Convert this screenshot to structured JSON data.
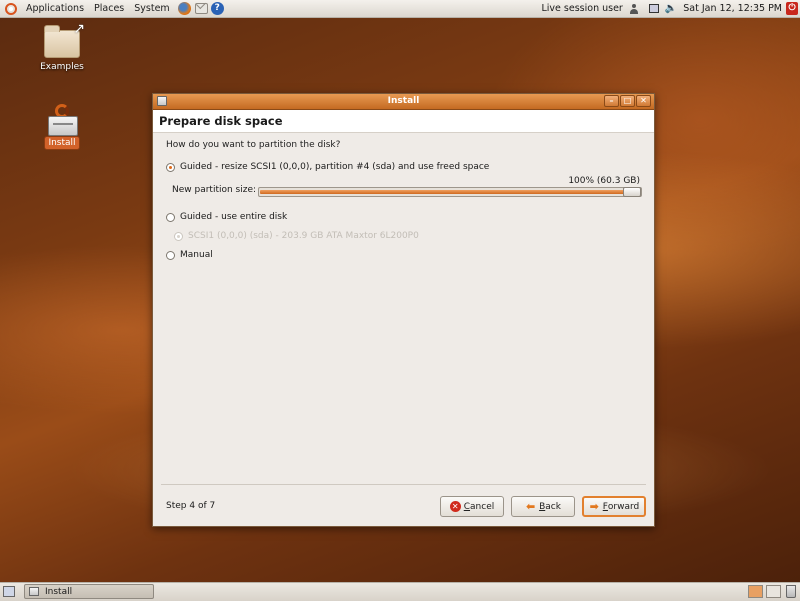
{
  "top_panel": {
    "menus": [
      "Applications",
      "Places",
      "System"
    ],
    "session_user": "Live session user",
    "clock": "Sat Jan 12, 12:35 PM"
  },
  "desktop": {
    "icons": [
      {
        "label": "Examples"
      },
      {
        "label": "Install"
      }
    ]
  },
  "window": {
    "title": "Install",
    "heading": "Prepare disk space",
    "question": "How do you want to partition the disk?",
    "options": [
      {
        "label": "Guided - resize SCSI1 (0,0,0), partition #4 (sda) and use freed space",
        "checked": true
      },
      {
        "label": "Guided - use entire disk",
        "checked": false
      },
      {
        "label": "Manual",
        "checked": false
      }
    ],
    "suboption": {
      "label": "SCSI1 (0,0,0) (sda) - 203.9 GB ATA Maxtor 6L200P0",
      "disabled": true
    },
    "slider": {
      "label": "New partition size:",
      "value_text": "100% (60.3 GB)",
      "fraction": 1.0
    },
    "step": "Step 4 of 7",
    "buttons": {
      "cancel": {
        "accel": "C",
        "rest": "ancel"
      },
      "back": {
        "accel": "B",
        "rest": "ack"
      },
      "forward": {
        "accel": "F",
        "rest": "orward"
      }
    }
  },
  "bottom_panel": {
    "task": "Install"
  },
  "colors": {
    "accent": "#e2802e",
    "titlebar": "#d07a34"
  }
}
